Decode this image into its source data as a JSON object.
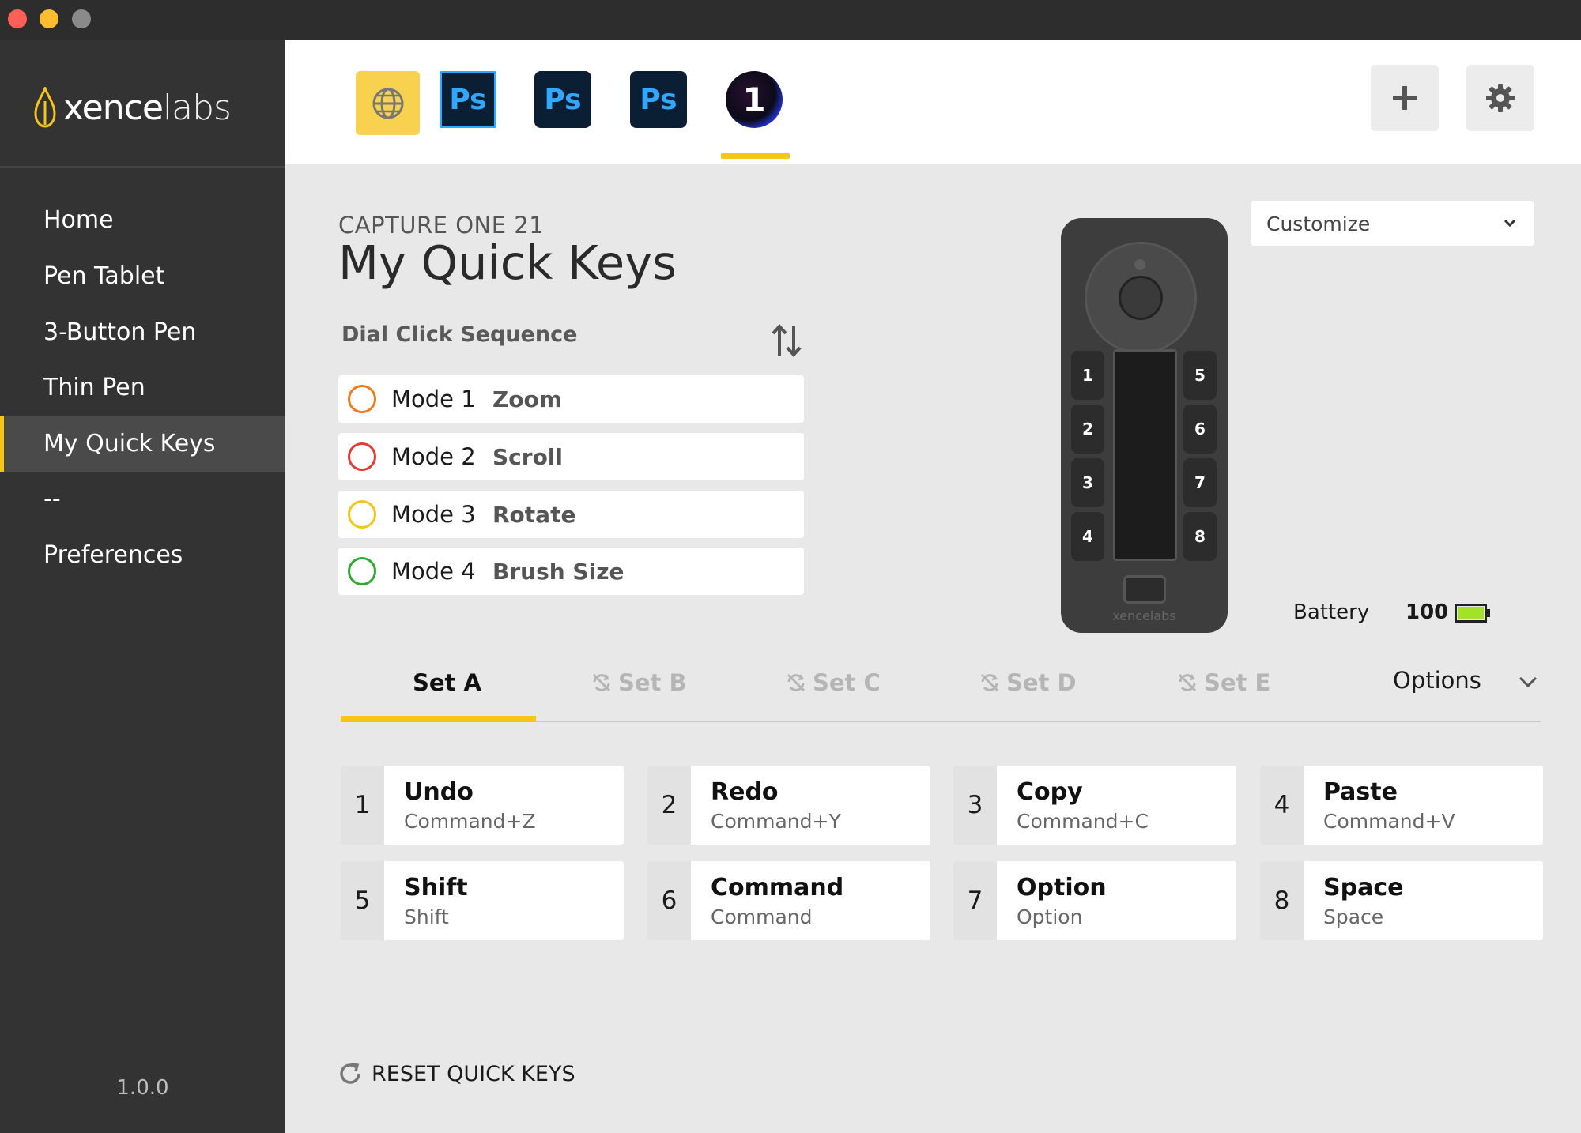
{
  "window": {
    "traffic_lights": [
      "close",
      "minimize",
      "zoom"
    ]
  },
  "sidebar": {
    "logo": {
      "brand_bold": "xence",
      "brand_light": "labs"
    },
    "items": [
      {
        "label": "Home"
      },
      {
        "label": "Pen Tablet"
      },
      {
        "label": "3-Button Pen"
      },
      {
        "label": "Thin Pen"
      },
      {
        "label": "My Quick Keys",
        "active": true
      },
      {
        "label": "--"
      },
      {
        "label": "Preferences"
      }
    ],
    "version": "1.0.0"
  },
  "topbar": {
    "apps": [
      {
        "name": "globe-icon",
        "label": ""
      },
      {
        "name": "photoshop-icon",
        "label": "Ps"
      },
      {
        "name": "photoshop-icon",
        "label": "Ps"
      },
      {
        "name": "photoshop-icon",
        "label": "Ps"
      },
      {
        "name": "capture-one-icon",
        "label": "1",
        "selected": true
      }
    ],
    "buttons": [
      "plus-icon",
      "gear-icon"
    ]
  },
  "heading": {
    "app_name": "CAPTURE ONE 21",
    "title": "My Quick Keys"
  },
  "dial": {
    "label": "Dial Click Sequence",
    "modes": [
      {
        "mode": "Mode 1",
        "action": "Zoom",
        "color": "#f07c1b"
      },
      {
        "mode": "Mode 2",
        "action": "Scroll",
        "color": "#e53935"
      },
      {
        "mode": "Mode 3",
        "action": "Rotate",
        "color": "#f5c518"
      },
      {
        "mode": "Mode 4",
        "action": "Brush Size",
        "color": "#2eaa2e"
      }
    ]
  },
  "device": {
    "left_keys": [
      "1",
      "2",
      "3",
      "4"
    ],
    "right_keys": [
      "5",
      "6",
      "7",
      "8"
    ],
    "brand": "xencelabs"
  },
  "customize": {
    "selected": "Customize"
  },
  "battery": {
    "label": "Battery",
    "value": "100",
    "level_percent": 100,
    "color": "#a4e22a"
  },
  "sets": {
    "tabs": [
      {
        "label": "Set A",
        "active": true
      },
      {
        "label": "Set B",
        "active": false
      },
      {
        "label": "Set C",
        "active": false
      },
      {
        "label": "Set D",
        "active": false
      },
      {
        "label": "Set E",
        "active": false
      }
    ],
    "options_label": "Options"
  },
  "keys": [
    {
      "num": "1",
      "name": "Undo",
      "combo": "Command+Z"
    },
    {
      "num": "2",
      "name": "Redo",
      "combo": "Command+Y"
    },
    {
      "num": "3",
      "name": "Copy",
      "combo": "Command+C"
    },
    {
      "num": "4",
      "name": "Paste",
      "combo": "Command+V"
    },
    {
      "num": "5",
      "name": "Shift",
      "combo": "Shift"
    },
    {
      "num": "6",
      "name": "Command",
      "combo": "Command"
    },
    {
      "num": "7",
      "name": "Option",
      "combo": "Option"
    },
    {
      "num": "8",
      "name": "Space",
      "combo": "Space"
    }
  ],
  "reset": {
    "label": "RESET QUICK KEYS"
  },
  "colors": {
    "accent": "#f5c518",
    "sidebar_bg": "#333333",
    "content_bg": "#e8e8e8"
  }
}
